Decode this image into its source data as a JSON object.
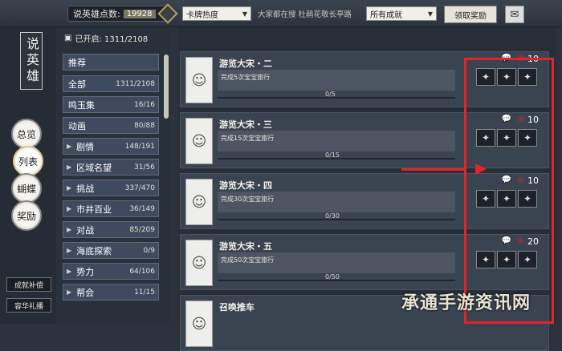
{
  "top": {
    "points_label": "说英雄点数:",
    "points_value": "19928",
    "sort": "卡牌热度",
    "search": "大家都在搜 杜鹃花敬长亭路",
    "filter": "所有成就",
    "claim": "领取奖励"
  },
  "left": {
    "title": "说英雄",
    "tabs": [
      "总览",
      "列表",
      "蝴蝶",
      "奖励"
    ],
    "bottom": [
      "成就补偿",
      "容华礼播"
    ]
  },
  "cats": {
    "opened": "已开启: 1311/2108",
    "items": [
      {
        "name": "推荐",
        "count": ""
      },
      {
        "name": "全部",
        "count": "1311/2108"
      },
      {
        "name": "鸣玉集",
        "count": "16/16"
      },
      {
        "name": "动画",
        "count": "80/88"
      },
      {
        "name": "剧情",
        "count": "148/191"
      },
      {
        "name": "区域名望",
        "count": "31/56"
      },
      {
        "name": "挑战",
        "count": "337/470"
      },
      {
        "name": "市井百业",
        "count": "36/149"
      },
      {
        "name": "对战",
        "count": "85/209"
      },
      {
        "name": "海底探索",
        "count": "0/9"
      },
      {
        "name": "势力",
        "count": "64/106"
      },
      {
        "name": "帮会",
        "count": "11/15"
      }
    ]
  },
  "cards": [
    {
      "title": "游览大宋・二",
      "task": "完成5次宝宝旅行",
      "progress": "0/5",
      "count": "10"
    },
    {
      "title": "游览大宋・三",
      "task": "完成15次宝宝旅行",
      "progress": "0/15",
      "count": "10"
    },
    {
      "title": "游览大宋・四",
      "task": "完成30次宝宝旅行",
      "progress": "0/30",
      "count": "10"
    },
    {
      "title": "游览大宋・五",
      "task": "完成50次宝宝旅行",
      "progress": "0/50",
      "count": "20"
    },
    {
      "title": "召唤推车",
      "task": "",
      "progress": "",
      "count": ""
    }
  ],
  "watermark": "承通手游资讯网"
}
